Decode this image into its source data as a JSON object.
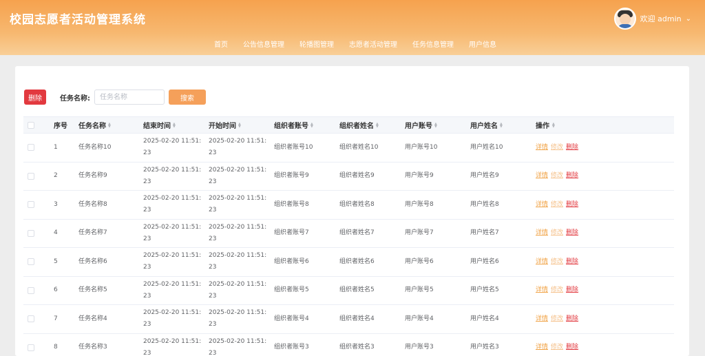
{
  "app": {
    "title": "校园志愿者活动管理系统"
  },
  "user": {
    "welcome": "欢迎 admin",
    "chevron_icon": "chevron-down-icon"
  },
  "nav": [
    {
      "label": "首页"
    },
    {
      "label": "公告信息管理"
    },
    {
      "label": "轮播图管理"
    },
    {
      "label": "志愿者活动管理"
    },
    {
      "label": "任务信息管理"
    },
    {
      "label": "用户信息"
    }
  ],
  "toolbar": {
    "delete_label": "删除",
    "search_label": "任务名称:",
    "search_placeholder": "任务名称",
    "search_value": "",
    "search_button": "搜索"
  },
  "table": {
    "headers": {
      "index": "序号",
      "name": "任务名称",
      "end": "结束时间",
      "start": "开始时间",
      "org_account": "组织者账号",
      "org_name": "组织者姓名",
      "user_account": "用户账号",
      "user_name": "用户姓名",
      "ops": "操作"
    },
    "op_labels": {
      "detail": "详情",
      "edit": "修改",
      "delete": "删除"
    },
    "rows": [
      {
        "index": "1",
        "name": "任务名称10",
        "end": "2025-02-20 11:51:23",
        "start": "2025-02-20 11:51:23",
        "org_account": "组织者账号10",
        "org_name": "组织者姓名10",
        "user_account": "用户账号10",
        "user_name": "用户姓名10"
      },
      {
        "index": "2",
        "name": "任务名称9",
        "end": "2025-02-20 11:51:23",
        "start": "2025-02-20 11:51:23",
        "org_account": "组织者账号9",
        "org_name": "组织者姓名9",
        "user_account": "用户账号9",
        "user_name": "用户姓名9"
      },
      {
        "index": "3",
        "name": "任务名称8",
        "end": "2025-02-20 11:51:23",
        "start": "2025-02-20 11:51:23",
        "org_account": "组织者账号8",
        "org_name": "组织者姓名8",
        "user_account": "用户账号8",
        "user_name": "用户姓名8"
      },
      {
        "index": "4",
        "name": "任务名称7",
        "end": "2025-02-20 11:51:23",
        "start": "2025-02-20 11:51:23",
        "org_account": "组织者账号7",
        "org_name": "组织者姓名7",
        "user_account": "用户账号7",
        "user_name": "用户姓名7"
      },
      {
        "index": "5",
        "name": "任务名称6",
        "end": "2025-02-20 11:51:23",
        "start": "2025-02-20 11:51:23",
        "org_account": "组织者账号6",
        "org_name": "组织者姓名6",
        "user_account": "用户账号6",
        "user_name": "用户姓名6"
      },
      {
        "index": "6",
        "name": "任务名称5",
        "end": "2025-02-20 11:51:23",
        "start": "2025-02-20 11:51:23",
        "org_account": "组织者账号5",
        "org_name": "组织者姓名5",
        "user_account": "用户账号5",
        "user_name": "用户姓名5"
      },
      {
        "index": "7",
        "name": "任务名称4",
        "end": "2025-02-20 11:51:23",
        "start": "2025-02-20 11:51:23",
        "org_account": "组织者账号4",
        "org_name": "组织者姓名4",
        "user_account": "用户账号4",
        "user_name": "用户姓名4"
      },
      {
        "index": "8",
        "name": "任务名称3",
        "end": "2025-02-20 11:51:23",
        "start": "2025-02-20 11:51:23",
        "org_account": "组织者账号3",
        "org_name": "组织者姓名3",
        "user_account": "用户账号3",
        "user_name": "用户姓名3"
      }
    ]
  },
  "colors": {
    "header_gradient_top": "#f6a24e",
    "delete_red": "#e2393f",
    "search_orange": "#f5a05a",
    "detail_link": "#f0a040"
  }
}
